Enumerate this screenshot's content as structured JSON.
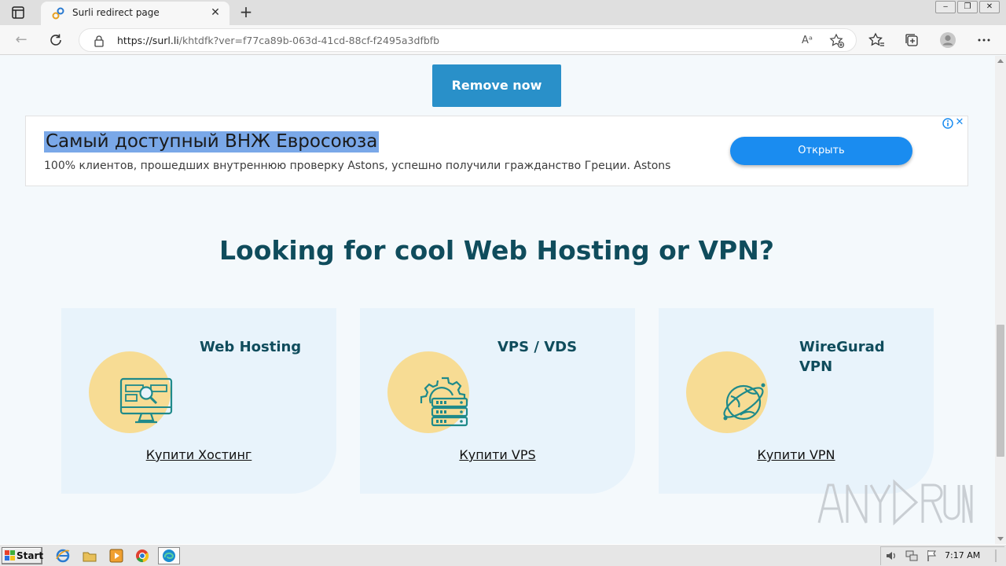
{
  "browser": {
    "tab_title": "Surli redirect page",
    "url_host": "https://surl.li",
    "url_path": "/khtdfk?ver=f77ca89b-063d-41cd-88cf-f2495a3dfbfb",
    "new_tab_symbol": "+",
    "close_symbol": "✕"
  },
  "page": {
    "remove_button": "Remove now",
    "ad": {
      "headline": "Самый доступный ВНЖ Евросоюза",
      "description": "100% клиентов, прошедших внутреннюю проверку Astons, успешно получили гражданство Греции. Astons",
      "cta": "Открыть"
    },
    "section_title": "Looking for cool Web Hosting or VPN?",
    "cards": [
      {
        "title": "Web Hosting",
        "icon": "monitor-search-icon",
        "link": "Купити Хостинг"
      },
      {
        "title": "VPS / VDS",
        "icon": "server-gear-icon",
        "link": "Купити VPS"
      },
      {
        "title_line1": "WireGurad",
        "title_line2": "VPN",
        "icon": "globe-vpn-icon",
        "link": "Купити VPN"
      }
    ],
    "watermark": "ANY RUN"
  },
  "taskbar": {
    "start_label": "Start",
    "clock": "7:17 AM"
  },
  "colors": {
    "accent": "#2990c9",
    "heading": "#0f4c5c",
    "card_bg": "#e8f3fb",
    "circle": "#f7dc94",
    "ad_button": "#1a8cf0"
  }
}
